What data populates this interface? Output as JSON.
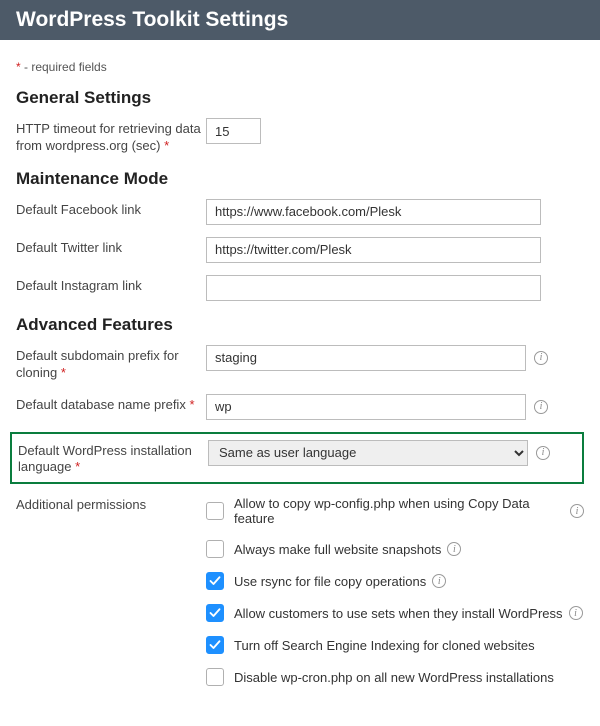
{
  "header": {
    "title": "WordPress Toolkit Settings"
  },
  "required_note_prefix": "*",
  "required_note_text": " - required fields",
  "sections": {
    "general": {
      "heading": "General Settings",
      "http_timeout": {
        "label": "HTTP timeout for retrieving data from wordpress.org (sec)",
        "value": "15",
        "required": true
      }
    },
    "maintenance": {
      "heading": "Maintenance Mode",
      "facebook": {
        "label": "Default Facebook link",
        "value": "https://www.facebook.com/Plesk"
      },
      "twitter": {
        "label": "Default Twitter link",
        "value": "https://twitter.com/Plesk"
      },
      "instagram": {
        "label": "Default Instagram link",
        "value": ""
      }
    },
    "advanced": {
      "heading": "Advanced Features",
      "subdomain_prefix": {
        "label": "Default subdomain prefix for cloning",
        "value": "staging",
        "required": true
      },
      "db_prefix": {
        "label": "Default database name prefix",
        "value": "wp",
        "required": true
      },
      "install_lang": {
        "label": "Default WordPress installation language",
        "value": "Same as user language",
        "required": true
      },
      "permissions_label": "Additional permissions",
      "permissions": [
        {
          "label": "Allow to copy wp-config.php when using Copy Data feature",
          "checked": false,
          "info": true
        },
        {
          "label": "Always make full website snapshots",
          "checked": false,
          "info": true
        },
        {
          "label": "Use rsync for file copy operations",
          "checked": true,
          "info": true
        },
        {
          "label": "Allow customers to use sets when they install WordPress",
          "checked": true,
          "info": true
        },
        {
          "label": "Turn off Search Engine Indexing for cloned websites",
          "checked": true,
          "info": false
        },
        {
          "label": "Disable wp-cron.php on all new WordPress installations",
          "checked": false,
          "info": false
        }
      ]
    }
  }
}
